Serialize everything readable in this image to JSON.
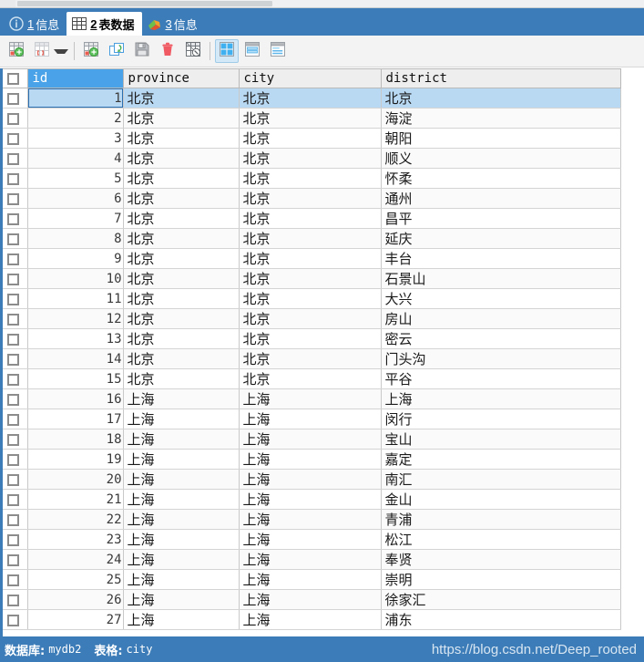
{
  "window": {
    "accent_color": "#3c7cb8",
    "selection_color": "#b9d9f3",
    "header_select_color": "#4aa3e8"
  },
  "tabbar": {
    "tabs": [
      {
        "num": "1",
        "label": "信息",
        "icon": "info-circle-icon",
        "active": false
      },
      {
        "num": "2",
        "label": "表数据",
        "icon": "table-grid-icon",
        "active": true
      },
      {
        "num": "3",
        "label": "信息",
        "icon": "color-blocks-icon",
        "active": false
      }
    ]
  },
  "toolbar": {
    "buttons": [
      {
        "name": "add-record-button",
        "icon": "grid-plus-icon",
        "selected": false
      },
      {
        "name": "insert-record-dropdown",
        "icon": "grid-brackets-icon",
        "selected": false,
        "caret": true
      },
      {
        "name": "duplicate-record-button",
        "icon": "grid-plus-alt-icon",
        "selected": false
      },
      {
        "name": "refresh-button",
        "icon": "refresh-arrow-icon",
        "selected": false
      },
      {
        "name": "save-button",
        "icon": "floppy-disk-icon",
        "selected": false
      },
      {
        "name": "delete-record-button",
        "icon": "trash-can-icon",
        "selected": false
      },
      {
        "name": "cancel-changes-button",
        "icon": "grid-cancel-icon",
        "selected": false
      },
      {
        "name": "grid-view-button",
        "icon": "grid-view-icon",
        "selected": true
      },
      {
        "name": "form-view-button",
        "icon": "form-view-icon",
        "selected": false
      },
      {
        "name": "text-view-button",
        "icon": "text-view-icon",
        "selected": false
      }
    ]
  },
  "grid": {
    "checkbox_header_icon": "checkbox-unchecked-icon",
    "columns": [
      {
        "key": "id",
        "label": "id",
        "selected": true
      },
      {
        "key": "province",
        "label": "province",
        "selected": false
      },
      {
        "key": "city",
        "label": "city",
        "selected": false
      },
      {
        "key": "district",
        "label": "district",
        "selected": false
      }
    ],
    "rows": [
      {
        "id": "1",
        "province": "北京",
        "city": "北京",
        "district": "北京",
        "selected": true
      },
      {
        "id": "2",
        "province": "北京",
        "city": "北京",
        "district": "海淀",
        "selected": false
      },
      {
        "id": "3",
        "province": "北京",
        "city": "北京",
        "district": "朝阳",
        "selected": false
      },
      {
        "id": "4",
        "province": "北京",
        "city": "北京",
        "district": "顺义",
        "selected": false
      },
      {
        "id": "5",
        "province": "北京",
        "city": "北京",
        "district": "怀柔",
        "selected": false
      },
      {
        "id": "6",
        "province": "北京",
        "city": "北京",
        "district": "通州",
        "selected": false
      },
      {
        "id": "7",
        "province": "北京",
        "city": "北京",
        "district": "昌平",
        "selected": false
      },
      {
        "id": "8",
        "province": "北京",
        "city": "北京",
        "district": "延庆",
        "selected": false
      },
      {
        "id": "9",
        "province": "北京",
        "city": "北京",
        "district": "丰台",
        "selected": false
      },
      {
        "id": "10",
        "province": "北京",
        "city": "北京",
        "district": "石景山",
        "selected": false
      },
      {
        "id": "11",
        "province": "北京",
        "city": "北京",
        "district": "大兴",
        "selected": false
      },
      {
        "id": "12",
        "province": "北京",
        "city": "北京",
        "district": "房山",
        "selected": false
      },
      {
        "id": "13",
        "province": "北京",
        "city": "北京",
        "district": "密云",
        "selected": false
      },
      {
        "id": "14",
        "province": "北京",
        "city": "北京",
        "district": "门头沟",
        "selected": false
      },
      {
        "id": "15",
        "province": "北京",
        "city": "北京",
        "district": "平谷",
        "selected": false
      },
      {
        "id": "16",
        "province": "上海",
        "city": "上海",
        "district": "上海",
        "selected": false
      },
      {
        "id": "17",
        "province": "上海",
        "city": "上海",
        "district": "闵行",
        "selected": false
      },
      {
        "id": "18",
        "province": "上海",
        "city": "上海",
        "district": "宝山",
        "selected": false
      },
      {
        "id": "19",
        "province": "上海",
        "city": "上海",
        "district": "嘉定",
        "selected": false
      },
      {
        "id": "20",
        "province": "上海",
        "city": "上海",
        "district": "南汇",
        "selected": false
      },
      {
        "id": "21",
        "province": "上海",
        "city": "上海",
        "district": "金山",
        "selected": false
      },
      {
        "id": "22",
        "province": "上海",
        "city": "上海",
        "district": "青浦",
        "selected": false
      },
      {
        "id": "23",
        "province": "上海",
        "city": "上海",
        "district": "松江",
        "selected": false
      },
      {
        "id": "24",
        "province": "上海",
        "city": "上海",
        "district": "奉贤",
        "selected": false
      },
      {
        "id": "25",
        "province": "上海",
        "city": "上海",
        "district": "崇明",
        "selected": false
      },
      {
        "id": "26",
        "province": "上海",
        "city": "上海",
        "district": "徐家汇",
        "selected": false
      },
      {
        "id": "27",
        "province": "上海",
        "city": "上海",
        "district": "浦东",
        "selected": false
      }
    ]
  },
  "statusbar": {
    "database_label": "数据库:",
    "database_value": "mydb2",
    "table_label": "表格:",
    "table_value": "city",
    "watermark": "https://blog.csdn.net/Deep_rooted"
  }
}
